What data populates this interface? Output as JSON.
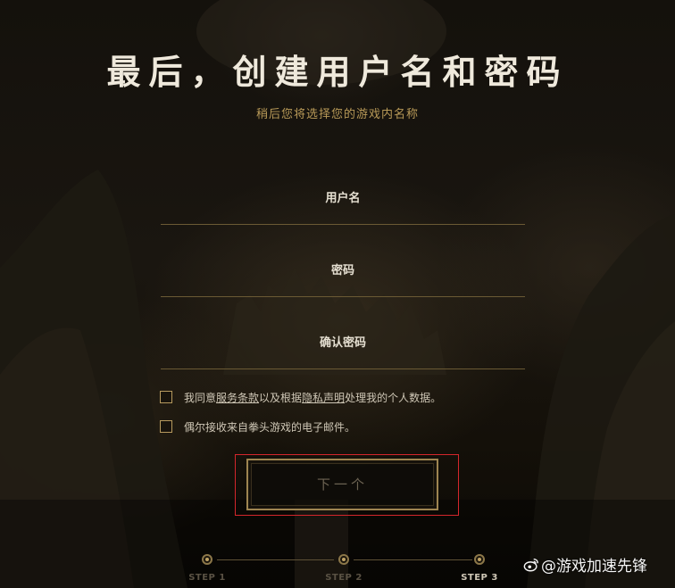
{
  "header": {
    "title": "最后，创建用户名和密码",
    "subtitle": "稍后您将选择您的游戏内名称"
  },
  "form": {
    "username": {
      "label": "用户名",
      "value": ""
    },
    "password": {
      "label": "密码",
      "value": ""
    },
    "confirm_password": {
      "label": "确认密码",
      "value": ""
    }
  },
  "consents": {
    "terms": {
      "prefix": "我同意",
      "link1": "服务条款",
      "middle": "以及根据",
      "link2": "隐私声明",
      "suffix": "处理我的个人数据。",
      "checked": false
    },
    "marketing": {
      "text": "偶尔接收来自拳头游戏的电子邮件。",
      "checked": false
    }
  },
  "actions": {
    "next_label": "下一个"
  },
  "steps": {
    "items": [
      {
        "label": "STEP 1",
        "active": false
      },
      {
        "label": "STEP 2",
        "active": false
      },
      {
        "label": "STEP 3",
        "active": true
      }
    ]
  },
  "watermark": {
    "text": "@游戏加速先锋",
    "icon": "weibo-like-logo-icon"
  },
  "colors": {
    "gold_accent": "#b99a58",
    "highlight_border": "#d4262c",
    "background": "#14110c"
  }
}
